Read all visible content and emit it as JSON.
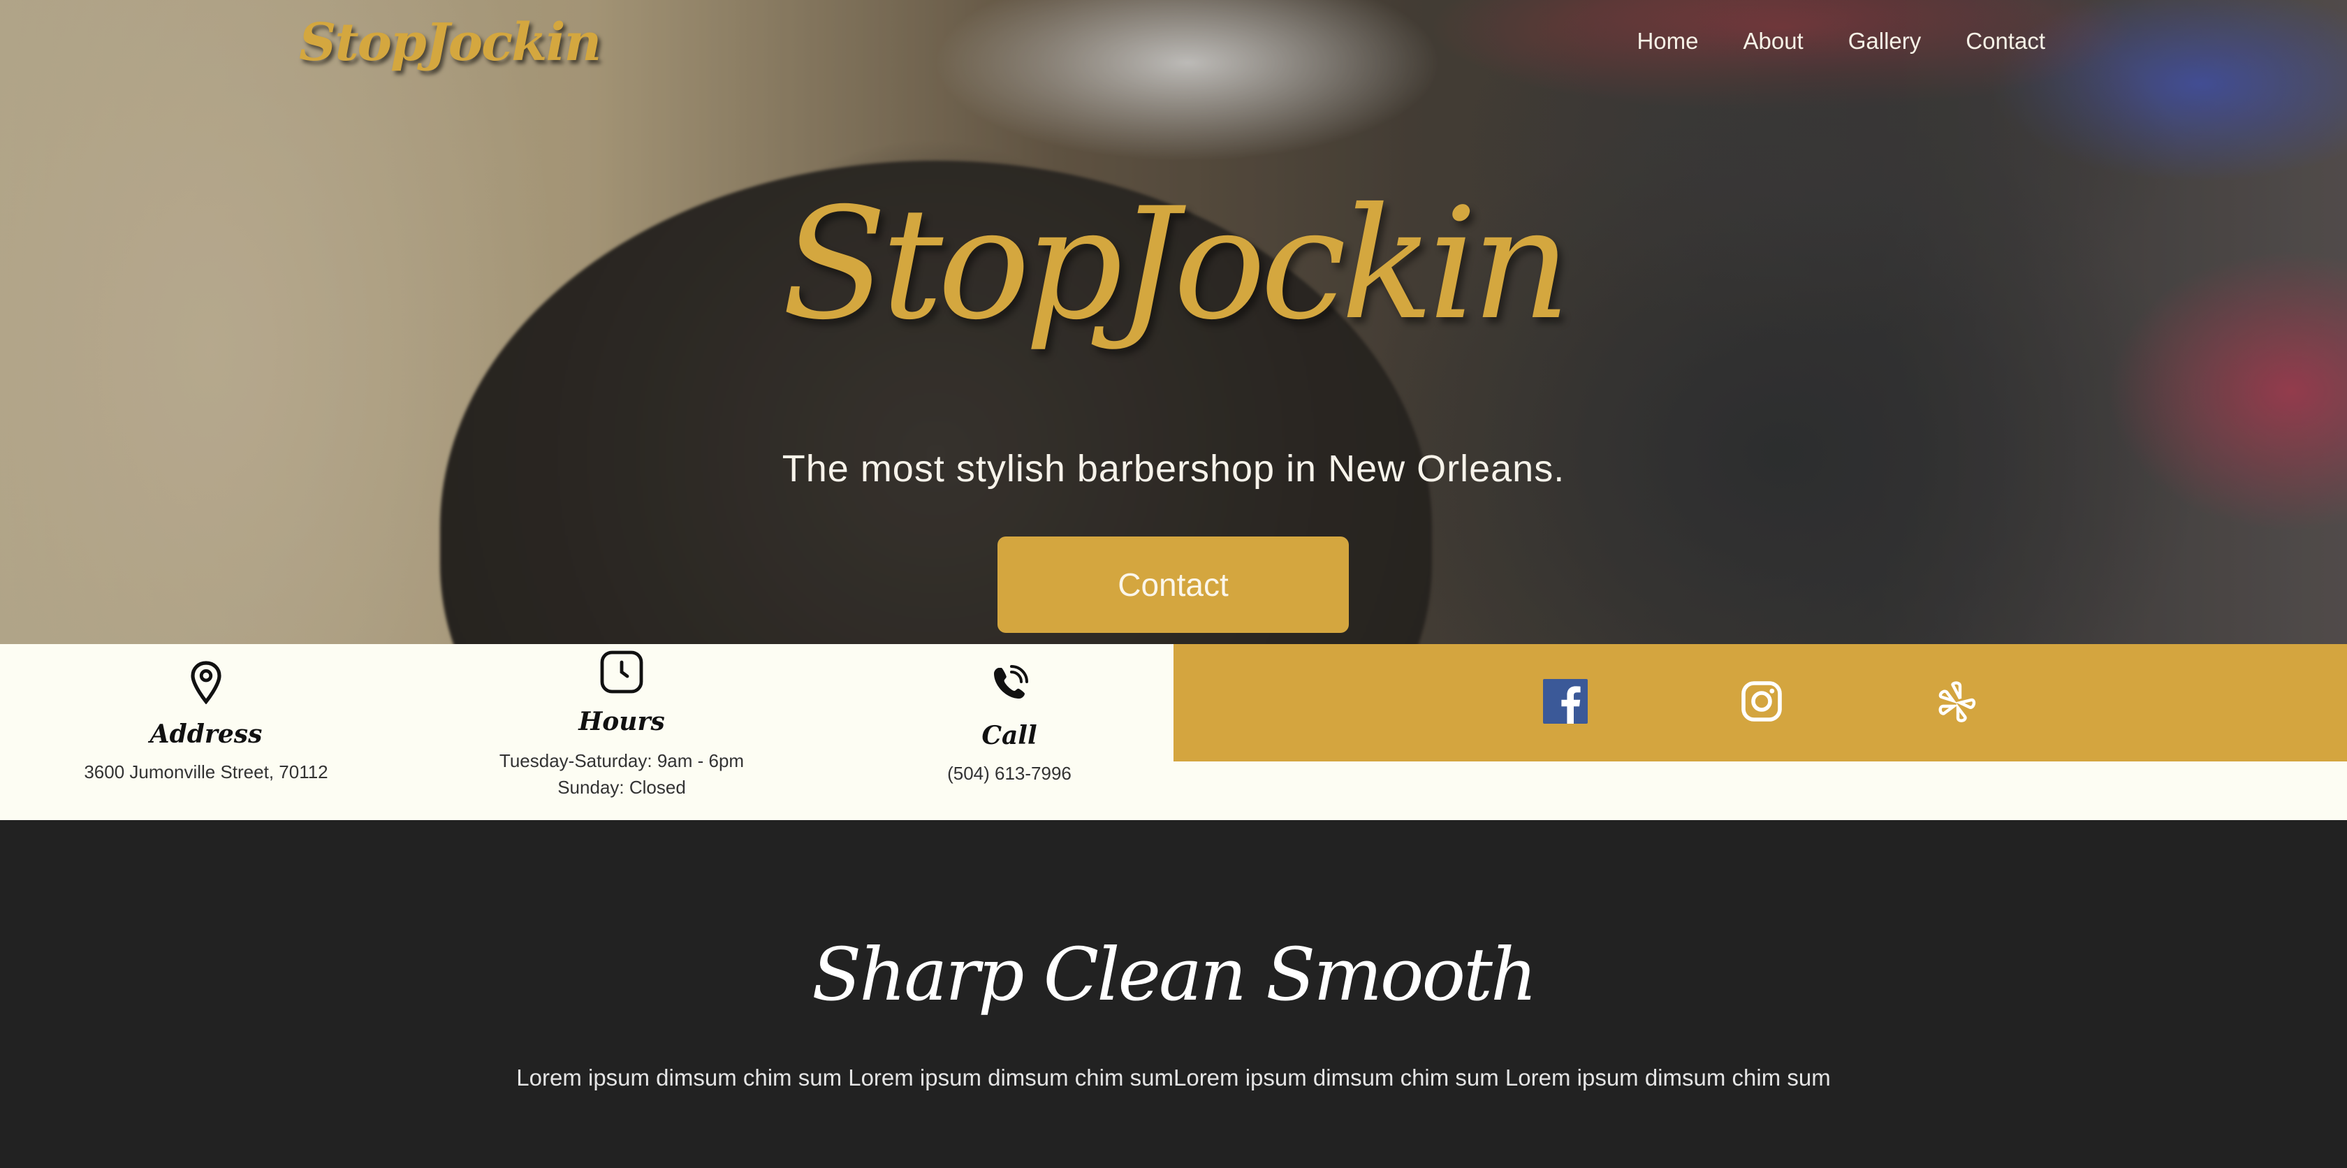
{
  "nav": {
    "logo": "StopJockin",
    "links": [
      "Home",
      "About",
      "Gallery",
      "Contact"
    ]
  },
  "hero": {
    "title": "StopJockin",
    "subtitle": "The most stylish barbershop in New Orleans.",
    "cta_label": "Contact"
  },
  "info": {
    "address": {
      "icon": "location-pin-icon",
      "label": "Address",
      "value": "3600 Jumonville Street, 70112"
    },
    "hours": {
      "icon": "clock-icon",
      "label": "Hours",
      "lines": [
        "Tuesday-Saturday: 9am - 6pm",
        "Sunday: Closed"
      ]
    },
    "call": {
      "icon": "phone-icon",
      "label": "Call",
      "value": "(504) 613-7996"
    }
  },
  "social": {
    "icons": [
      "facebook-icon",
      "instagram-icon",
      "yelp-icon"
    ]
  },
  "section": {
    "tagline": "Sharp Clean Smooth",
    "body": "Lorem ipsum dimsum chim sum Lorem ipsum dimsum chim sumLorem ipsum dimsum chim sum Lorem ipsum dimsum chim sum"
  },
  "colors": {
    "accent": "#d4a53f",
    "cream": "#fdfdf3",
    "dark": "#222222"
  }
}
